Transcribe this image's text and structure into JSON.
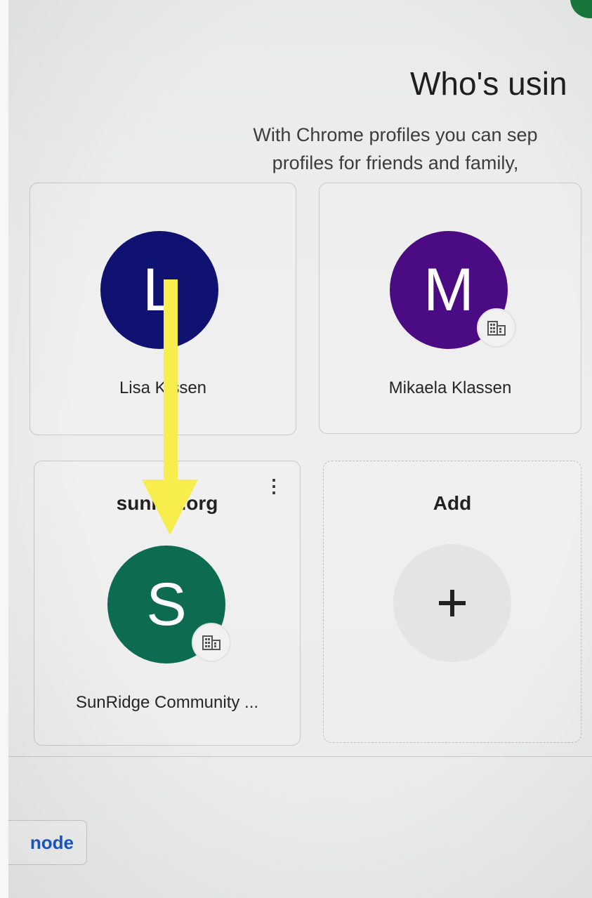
{
  "header": {
    "title": "Who's usin",
    "subtitle_line1": "With Chrome profiles you can sep",
    "subtitle_line2": "profiles for friends and family,"
  },
  "profiles": [
    {
      "initial": "L",
      "name": "Lisa K    ssen",
      "color": "#0f1271",
      "managed": false
    },
    {
      "initial": "M",
      "name": "Mikaela Klassen",
      "color": "#4b0b82",
      "managed": true
    },
    {
      "org": "sunri    e.org",
      "initial": "S",
      "name": "SunRidge Community ...",
      "color": "#0d6b52",
      "managed": true
    }
  ],
  "add_card": {
    "label": "Add",
    "icon": "plus-icon"
  },
  "footer": {
    "guest_button_label": "node"
  },
  "annotation": {
    "arrow_color": "#f7ee4e",
    "icon": "down-arrow"
  },
  "icons": {
    "managed_badge": "building-icon",
    "menu": "more-vert-icon"
  }
}
